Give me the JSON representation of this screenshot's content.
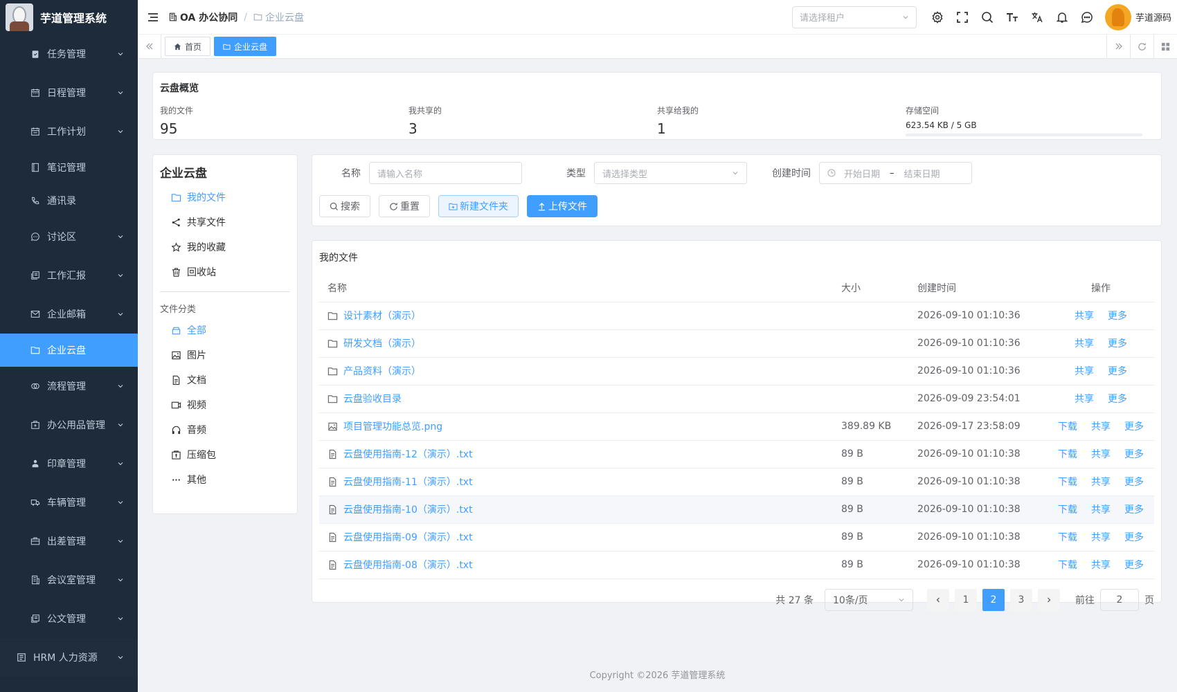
{
  "app": {
    "title": "芋道管理系统"
  },
  "sidebar": {
    "items": [
      {
        "label": "任务管理",
        "icon": "task-icon",
        "chevron": true
      },
      {
        "label": "日程管理",
        "icon": "calendar-icon",
        "chevron": true
      },
      {
        "label": "工作计划",
        "icon": "plan-icon",
        "chevron": true
      },
      {
        "label": "笔记管理",
        "icon": "note-icon",
        "chevron": false
      },
      {
        "label": "通讯录",
        "icon": "phone-icon",
        "chevron": false
      },
      {
        "label": "讨论区",
        "icon": "chat-icon",
        "chevron": true
      },
      {
        "label": "工作汇报",
        "icon": "report-icon",
        "chevron": true
      },
      {
        "label": "企业邮箱",
        "icon": "mail-icon",
        "chevron": true
      },
      {
        "label": "企业云盘",
        "icon": "folder-icon",
        "chevron": false,
        "active": true
      },
      {
        "label": "流程管理",
        "icon": "flow-icon",
        "chevron": true
      },
      {
        "label": "办公用品管理",
        "icon": "supplies-icon",
        "chevron": true
      },
      {
        "label": "印章管理",
        "icon": "seal-icon",
        "chevron": true
      },
      {
        "label": "车辆管理",
        "icon": "car-icon",
        "chevron": true
      },
      {
        "label": "出差管理",
        "icon": "briefcase-icon",
        "chevron": true
      },
      {
        "label": "会议室管理",
        "icon": "building-icon",
        "chevron": true
      },
      {
        "label": "公文管理",
        "icon": "document-icon",
        "chevron": true
      }
    ],
    "hrm_label": "HRM 人力资源"
  },
  "header": {
    "breadcrumb": [
      "OA 办公协同",
      "企业云盘"
    ],
    "tenant_placeholder": "请选择租户",
    "username": "芋道源码"
  },
  "tags": {
    "home": "首页",
    "current": "企业云盘"
  },
  "overview": {
    "title": "云盘概览",
    "stats": [
      {
        "label": "我的文件",
        "value": "95"
      },
      {
        "label": "我共享的",
        "value": "3"
      },
      {
        "label": "共享给我的",
        "value": "1"
      }
    ],
    "storage_label": "存储空间",
    "storage_value": "623.54 KB / 5 GB",
    "storage_used_fraction": 0.0001
  },
  "leftnav": {
    "title": "企业云盘",
    "items": [
      {
        "label": "我的文件",
        "icon": "folder-icon",
        "active": true
      },
      {
        "label": "共享文件",
        "icon": "share-icon"
      },
      {
        "label": "我的收藏",
        "icon": "star-icon"
      },
      {
        "label": "回收站",
        "icon": "trash-icon"
      }
    ],
    "category_title": "文件分类",
    "categories": [
      {
        "label": "全部",
        "icon": "all-icon",
        "active": true
      },
      {
        "label": "图片",
        "icon": "image-icon"
      },
      {
        "label": "文档",
        "icon": "doc-icon"
      },
      {
        "label": "视频",
        "icon": "video-icon"
      },
      {
        "label": "音频",
        "icon": "audio-icon"
      },
      {
        "label": "压缩包",
        "icon": "zip-icon"
      },
      {
        "label": "其他",
        "icon": "more-icon"
      }
    ]
  },
  "filter": {
    "name_label": "名称",
    "name_placeholder": "请输入名称",
    "type_label": "类型",
    "type_placeholder": "请选择类型",
    "created_label": "创建时间",
    "start_placeholder": "开始日期",
    "range_sep": "–",
    "end_placeholder": "结束日期",
    "buttons": {
      "search": "搜索",
      "reset": "重置",
      "new_folder": "新建文件夹",
      "upload": "上传文件"
    }
  },
  "files": {
    "title": "我的文件",
    "columns": {
      "name": "名称",
      "size": "大小",
      "created": "创建时间",
      "actions": "操作"
    },
    "rows": [
      {
        "name": "设计素材（演示）",
        "type": "folder",
        "size": "",
        "created": "2026-09-10 01:10:36",
        "actions": [
          "共享",
          "更多"
        ]
      },
      {
        "name": "研发文档（演示）",
        "type": "folder",
        "size": "",
        "created": "2026-09-10 01:10:36",
        "actions": [
          "共享",
          "更多"
        ]
      },
      {
        "name": "产品资料（演示）",
        "type": "folder",
        "size": "",
        "created": "2026-09-10 01:10:36",
        "actions": [
          "共享",
          "更多"
        ]
      },
      {
        "name": "云盘验收目录",
        "type": "folder",
        "size": "",
        "created": "2026-09-09 23:54:01",
        "actions": [
          "共享",
          "更多"
        ]
      },
      {
        "name": "项目管理功能总览.png",
        "type": "image",
        "size": "389.89 KB",
        "created": "2026-09-17 23:58:09",
        "actions": [
          "下载",
          "共享",
          "更多"
        ]
      },
      {
        "name": "云盘使用指南-12（演示）.txt",
        "type": "doc",
        "size": "89 B",
        "created": "2026-09-10 01:10:38",
        "actions": [
          "下载",
          "共享",
          "更多"
        ]
      },
      {
        "name": "云盘使用指南-11（演示）.txt",
        "type": "doc",
        "size": "89 B",
        "created": "2026-09-10 01:10:38",
        "actions": [
          "下载",
          "共享",
          "更多"
        ]
      },
      {
        "name": "云盘使用指南-10（演示）.txt",
        "type": "doc",
        "size": "89 B",
        "created": "2026-09-10 01:10:38",
        "actions": [
          "下载",
          "共享",
          "更多"
        ],
        "highlight": true
      },
      {
        "name": "云盘使用指南-09（演示）.txt",
        "type": "doc",
        "size": "89 B",
        "created": "2026-09-10 01:10:38",
        "actions": [
          "下载",
          "共享",
          "更多"
        ]
      },
      {
        "name": "云盘使用指南-08（演示）.txt",
        "type": "doc",
        "size": "89 B",
        "created": "2026-09-10 01:10:38",
        "actions": [
          "下载",
          "共享",
          "更多"
        ]
      }
    ]
  },
  "pagination": {
    "total_text": "共 27 条",
    "page_size": "10条/页",
    "pages": [
      "1",
      "2",
      "3"
    ],
    "current": "2",
    "goto_label": "前往",
    "goto_value": "2",
    "page_unit": "页"
  },
  "footer": {
    "copyright": "Copyright ©2026 芋道管理系统"
  },
  "colors": {
    "primary": "#409eff",
    "sidebar_bg": "#1d2b3a",
    "sidebar_text": "#bfcbd9"
  }
}
